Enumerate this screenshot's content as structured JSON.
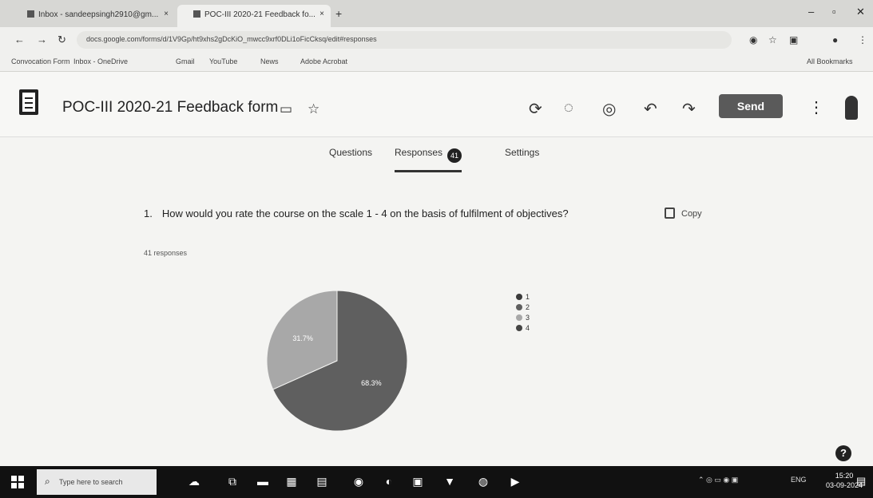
{
  "browser": {
    "tabs": [
      {
        "title": "Inbox - sandeepsingh2910@gm..."
      },
      {
        "title": "POC-III 2020-21 Feedback fo..."
      }
    ],
    "tab_close": "×",
    "new_tab": "+",
    "url": "docs.google.com/forms/d/1V9Gp/ht9xhs2gDcKiO_mwcc9xrf0DLi1oFicCksq/edit#responses",
    "bookmarks": [
      "Convocation Form",
      "Inbox - OneDrive",
      "Gmail",
      "YouTube",
      "News",
      "Adobe Acrobat"
    ],
    "all_bookmarks": "All Bookmarks"
  },
  "form": {
    "title": "POC-III 2020-21 Feedback form",
    "send_label": "Send",
    "tabs": [
      {
        "label": "Questions"
      },
      {
        "label": "Responses",
        "count": "41"
      },
      {
        "label": "Settings"
      }
    ]
  },
  "question": {
    "number": "1.",
    "text": "How would you rate the course on the scale 1 - 4 on the basis of fulfilment of objectives?",
    "copy_label": "Copy",
    "responses_label": "41 responses"
  },
  "chart_data": {
    "type": "pie",
    "labels": [
      "1",
      "2",
      "3",
      "4"
    ],
    "values": [
      0,
      68.3,
      31.7,
      0
    ],
    "slice_labels": [
      "",
      "68.3%",
      "31.7%",
      ""
    ],
    "colors": [
      "#3a3a3a",
      "#5f5f5f",
      "#a8a8a8",
      "#444444"
    ],
    "legend": "right"
  },
  "help_label": "?",
  "taskbar": {
    "search_placeholder": "Type here to search",
    "tray": "ENG",
    "time": "15:20",
    "date": "03-09-2024"
  }
}
